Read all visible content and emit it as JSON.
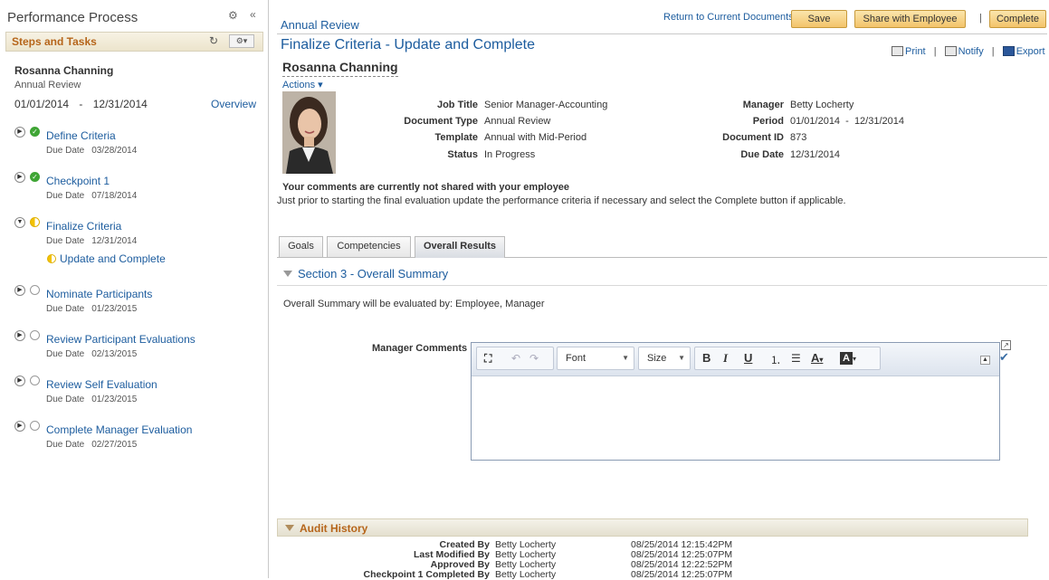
{
  "left_panel": {
    "title": "Performance Process",
    "steps_header": "Steps and Tasks",
    "employee_name": "Rosanna Channing",
    "document_type": "Annual Review",
    "period_start": "01/01/2014",
    "period_sep": "-",
    "period_end": "12/31/2014",
    "overview_link": "Overview",
    "tasks": [
      {
        "name": "Define Criteria",
        "due_label": "Due Date",
        "due_date": "03/28/2014",
        "status": "complete"
      },
      {
        "name": "Checkpoint 1",
        "due_label": "Due Date",
        "due_date": "07/18/2014",
        "status": "complete"
      },
      {
        "name": "Finalize Criteria",
        "due_label": "Due Date",
        "due_date": "12/31/2014",
        "status": "in-progress"
      },
      {
        "name": "Nominate Participants",
        "due_label": "Due Date",
        "due_date": "01/23/2015",
        "status": "not-started"
      },
      {
        "name": "Review Participant Evaluations",
        "due_label": "Due Date",
        "due_date": "02/13/2015",
        "status": "not-started"
      },
      {
        "name": "Review Self Evaluation",
        "due_label": "Due Date",
        "due_date": "01/23/2015",
        "status": "not-started"
      },
      {
        "name": "Complete Manager Evaluation",
        "due_label": "Due Date",
        "due_date": "02/27/2015",
        "status": "not-started"
      }
    ],
    "subtask": "Update and Complete"
  },
  "header": {
    "breadcrumb": "Annual Review",
    "return_link": "Return to Current Documents",
    "save_label": "Save",
    "share_label": "Share with Employee",
    "separator": "|",
    "complete_label": "Complete",
    "page_title": "Finalize Criteria - Update and Complete",
    "print_link": "Print",
    "notify_link": "Notify",
    "export_link": "Export",
    "pipe": "|"
  },
  "employee": {
    "name": "Rosanna Channing",
    "actions_label": "Actions ▾"
  },
  "details_left": [
    {
      "label": "Job Title",
      "value": "Senior Manager-Accounting"
    },
    {
      "label": "Document Type",
      "value": "Annual Review"
    },
    {
      "label": "Template",
      "value": "Annual with Mid-Period"
    },
    {
      "label": "Status",
      "value": "In Progress"
    }
  ],
  "details_right": [
    {
      "label": "Manager",
      "value": "Betty Locherty"
    },
    {
      "label": "Period",
      "value": "01/01/2014  -  12/31/2014"
    },
    {
      "label": "Document ID",
      "value": "873"
    },
    {
      "label": "Due Date",
      "value": "12/31/2014"
    }
  ],
  "notice": {
    "bold": "Your comments are currently not shared with your employee",
    "text": "Just prior to starting the final evaluation update the performance criteria if necessary and select the Complete button if applicable."
  },
  "tabs": [
    "Goals",
    "Competencies",
    "Overall Results"
  ],
  "active_tab": "Overall Results",
  "section": {
    "title": "Section 3 - Overall Summary",
    "evaluated_by": "Overall Summary will be evaluated by: Employee, Manager",
    "manager_comments_label": "Manager Comments"
  },
  "editor": {
    "font_label": "Font",
    "size_label": "Size",
    "bold": "B",
    "italic": "I",
    "underline": "U",
    "text_color": "A",
    "bg_color": "A",
    "content": ""
  },
  "audit": {
    "title": "Audit History",
    "rows": [
      {
        "label": "Created By",
        "user": "Betty Locherty",
        "timestamp": "08/25/2014 12:15:42PM"
      },
      {
        "label": "Last Modified By",
        "user": "Betty Locherty",
        "timestamp": "08/25/2014 12:25:07PM"
      },
      {
        "label": "Approved By",
        "user": "Betty Locherty",
        "timestamp": "08/25/2014 12:22:52PM"
      },
      {
        "label": "Checkpoint 1 Completed By",
        "user": "Betty Locherty",
        "timestamp": "08/25/2014 12:25:07PM"
      }
    ]
  },
  "colors": {
    "link": "#1c5c9e",
    "section_header": "#b6651a",
    "button_fill": "#f3c36a",
    "complete_green": "#3fa535",
    "progress_yellow": "#f3c200"
  }
}
